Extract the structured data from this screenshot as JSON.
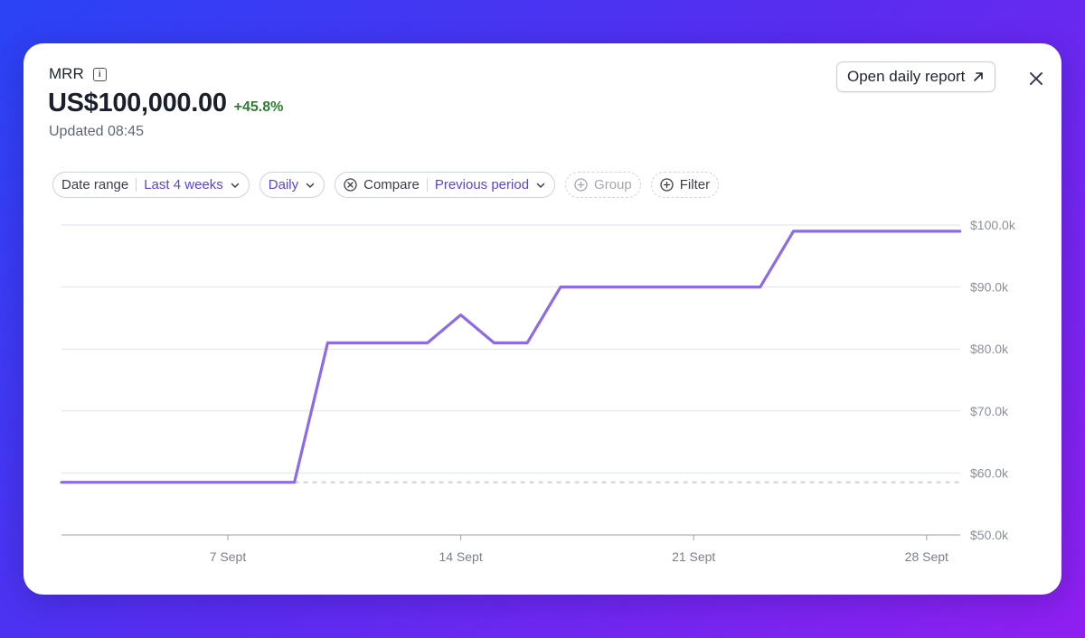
{
  "header": {
    "metric_name": "MRR",
    "info_icon": "info-icon",
    "value": "US$100,000.00",
    "delta": "+45.8%",
    "delta_color": "#2f7d32",
    "updated": "Updated 08:45",
    "report_button": "Open daily report",
    "report_icon": "arrow-up-right-icon",
    "close_icon": "close-icon"
  },
  "filters": {
    "date_range_label": "Date range",
    "date_range_value": "Last 4 weeks",
    "interval_value": "Daily",
    "compare_label": "Compare",
    "compare_value": "Previous period",
    "group_label": "Group",
    "filter_label": "Filter"
  },
  "colors": {
    "accent": "#5b45d6",
    "series": "#8b6be6",
    "comparison": "#d6d9df"
  },
  "chart_data": {
    "type": "line",
    "x_ticks": [
      "7 Sept",
      "14 Sept",
      "21 Sept",
      "28 Sept"
    ],
    "y_ticks": [
      "$50.0k",
      "$60.0k",
      "$70.0k",
      "$80.0k",
      "$90.0k",
      "$100.0k"
    ],
    "ylim": [
      50000,
      100000
    ],
    "grid": true,
    "series": [
      {
        "x": [
          "2 Sept",
          "3 Sept",
          "4 Sept",
          "5 Sept",
          "6 Sept",
          "7 Sept",
          "8 Sept",
          "9 Sept",
          "10 Sept",
          "11 Sept",
          "12 Sept",
          "13 Sept",
          "14 Sept",
          "15 Sept",
          "16 Sept",
          "17 Sept",
          "18 Sept",
          "19 Sept",
          "20 Sept",
          "21 Sept",
          "22 Sept",
          "23 Sept",
          "24 Sept",
          "25 Sept",
          "26 Sept",
          "27 Sept",
          "28 Sept",
          "29 Sept"
        ],
        "values": [
          58500,
          58500,
          58500,
          58500,
          58500,
          58500,
          58500,
          58500,
          81000,
          81000,
          81000,
          81000,
          85500,
          81000,
          81000,
          90000,
          90000,
          90000,
          90000,
          90000,
          90000,
          90000,
          99000,
          99000,
          99000,
          99000,
          99000,
          99000
        ]
      },
      {
        "x": [
          "9 Sept",
          "29 Sept"
        ],
        "values": [
          58500,
          58500
        ],
        "style": "dotted"
      }
    ]
  }
}
